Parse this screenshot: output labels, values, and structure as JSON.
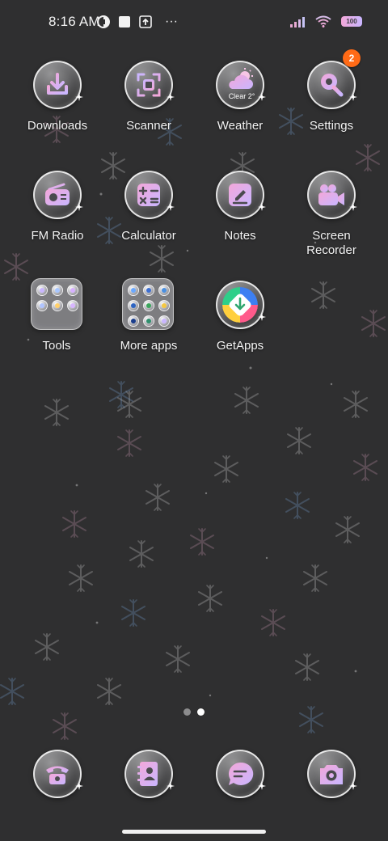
{
  "status_bar": {
    "time": "8:16 AM",
    "battery_level": "100",
    "more_label": "···"
  },
  "apps": {
    "downloads": {
      "label": "Downloads",
      "icon": "download-icon"
    },
    "scanner": {
      "label": "Scanner",
      "icon": "scanner-icon"
    },
    "weather": {
      "label": "Weather",
      "icon": "weather-icon",
      "sub": "Clear 2°"
    },
    "settings": {
      "label": "Settings",
      "icon": "settings-icon",
      "badge": "2"
    },
    "fm_radio": {
      "label": "FM Radio",
      "icon": "radio-icon"
    },
    "calculator": {
      "label": "Calculator",
      "icon": "calculator-icon"
    },
    "notes": {
      "label": "Notes",
      "icon": "notes-icon"
    },
    "screen_recorder": {
      "label": "Screen\nRecorder",
      "icon": "video-camera-icon"
    },
    "tools": {
      "label": "Tools",
      "icon": "folder-icon"
    },
    "more_apps": {
      "label": "More apps",
      "icon": "folder-icon"
    },
    "getapps": {
      "label": "GetApps",
      "icon": "getapps-icon"
    }
  },
  "dock": {
    "phone": {
      "icon": "phone-icon"
    },
    "contacts": {
      "icon": "contacts-icon"
    },
    "messages": {
      "icon": "messages-icon"
    },
    "camera": {
      "icon": "camera-icon"
    }
  },
  "pages": {
    "count": 2,
    "active_index": 1
  },
  "colors": {
    "background": "#2f2f30",
    "badge": "#ff6a16",
    "icon_pink": "#f3a7d9",
    "icon_lilac": "#c9b6ff"
  }
}
